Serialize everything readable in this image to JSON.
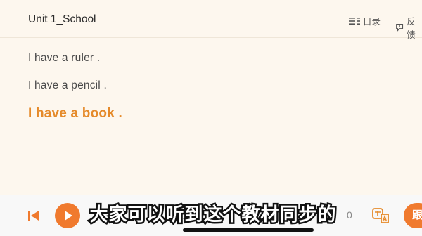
{
  "header": {
    "title": "Unit 1_School",
    "menu_label": "目录",
    "feedback_label": "反馈"
  },
  "lines": [
    {
      "text": "I have a ruler .",
      "active": false
    },
    {
      "text": "I have a pencil .",
      "active": false
    },
    {
      "text": "I have a book .",
      "active": true
    }
  ],
  "player": {
    "number_text": "0",
    "follow_label": "跟"
  },
  "subtitle": "大家可以听到这个教材同步的",
  "colors": {
    "accent": "#f07a2e",
    "active_text": "#e58a2a",
    "background": "#fdf7ee"
  }
}
